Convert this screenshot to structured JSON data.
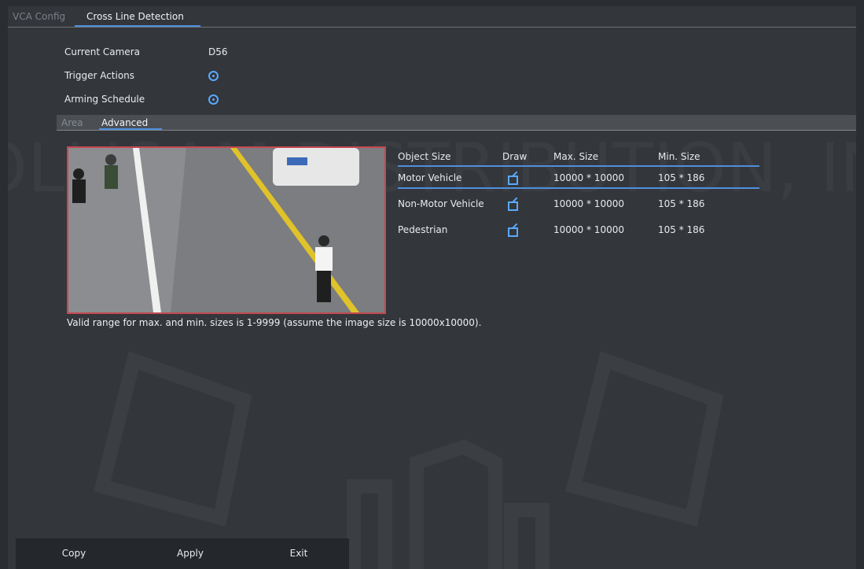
{
  "tabs": [
    "VCA Config",
    "Cross Line Detection"
  ],
  "current_camera": {
    "label": "Current Camera",
    "value": "D56"
  },
  "trigger_actions": {
    "label": "Trigger Actions"
  },
  "arming_schedule": {
    "label": "Arming Schedule"
  },
  "subtabs": [
    "Area",
    "Advanced"
  ],
  "table": {
    "headers": [
      "Object Size",
      "Draw",
      "Max. Size",
      "Min. Size"
    ],
    "rows": [
      {
        "name": "Motor Vehicle",
        "max": "10000 * 10000",
        "min": "105 * 186"
      },
      {
        "name": "Non-Motor Vehicle",
        "max": "10000 * 10000",
        "min": "105 * 186"
      },
      {
        "name": "Pedestrian",
        "max": "10000 * 10000",
        "min": "105 * 186"
      }
    ]
  },
  "note": "Valid range for max. and min. sizes is 1-9999 (assume the image size is 10000x10000).",
  "footer_buttons": [
    "Copy",
    "Apply",
    "Exit"
  ],
  "watermark": "COLLISAM DISTRIBUTION, INC",
  "colors": {
    "accent": "#4f8fdc",
    "icon": "#5aa9ff",
    "selection_border": "#c4484f"
  }
}
